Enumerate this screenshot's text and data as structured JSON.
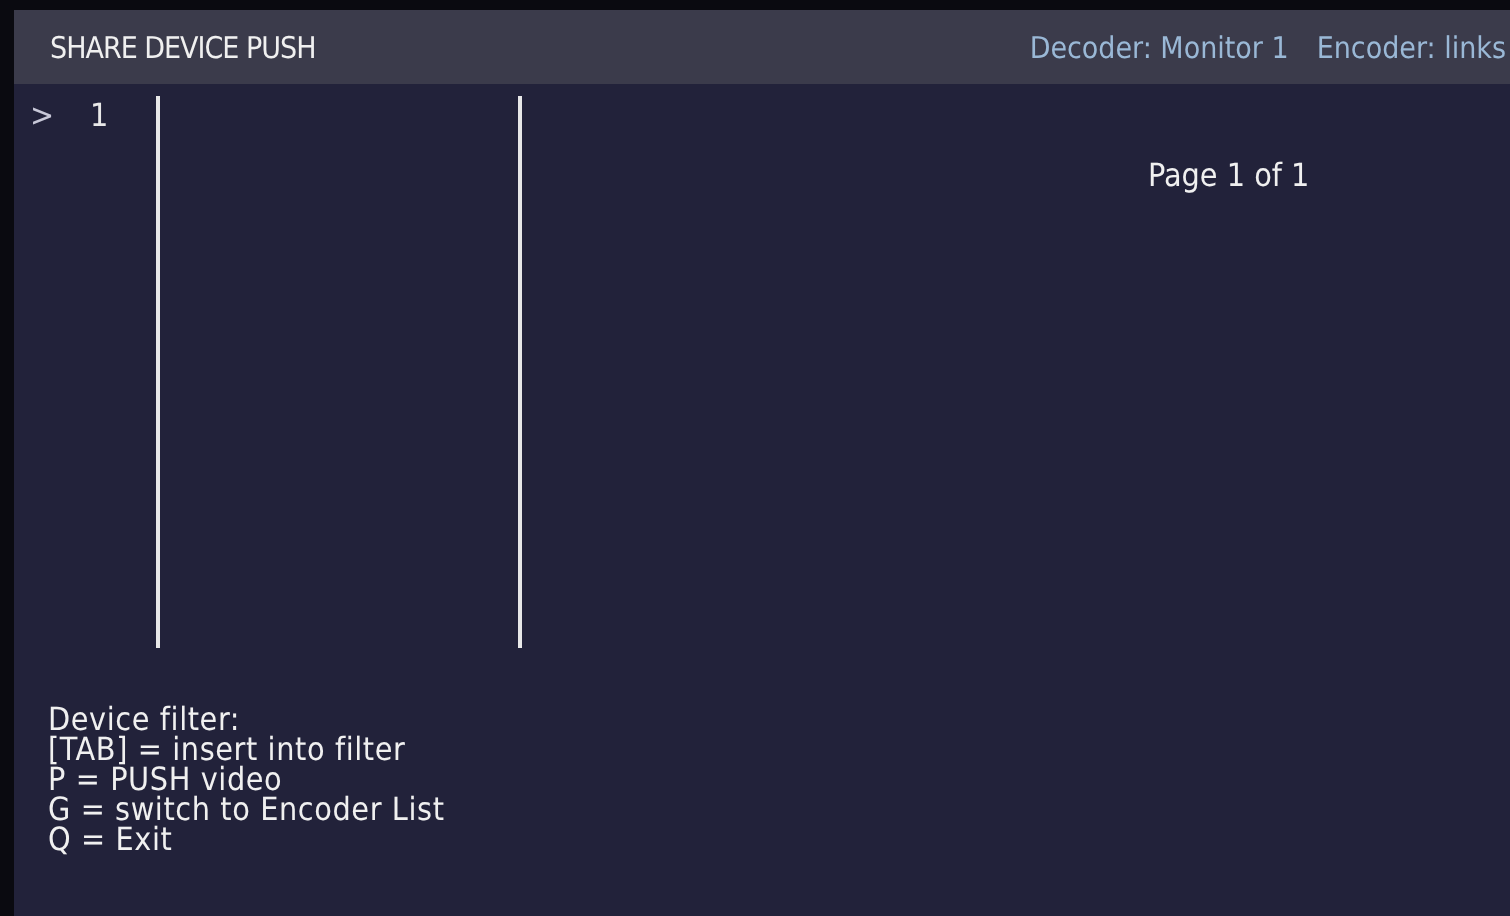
{
  "header": {
    "title": "SHARE DEVICE PUSH",
    "decoder": "Decoder: Monitor 1",
    "encoder": "Encoder: links"
  },
  "rows": [
    {
      "cursor": ">",
      "number": "1",
      "selected": true
    }
  ],
  "pager": "Page 1 of 1",
  "help": [
    "Device filter:",
    "[TAB] = insert into filter",
    "P = PUSH video",
    "G = switch to Encoder List",
    "Q = Exit"
  ]
}
